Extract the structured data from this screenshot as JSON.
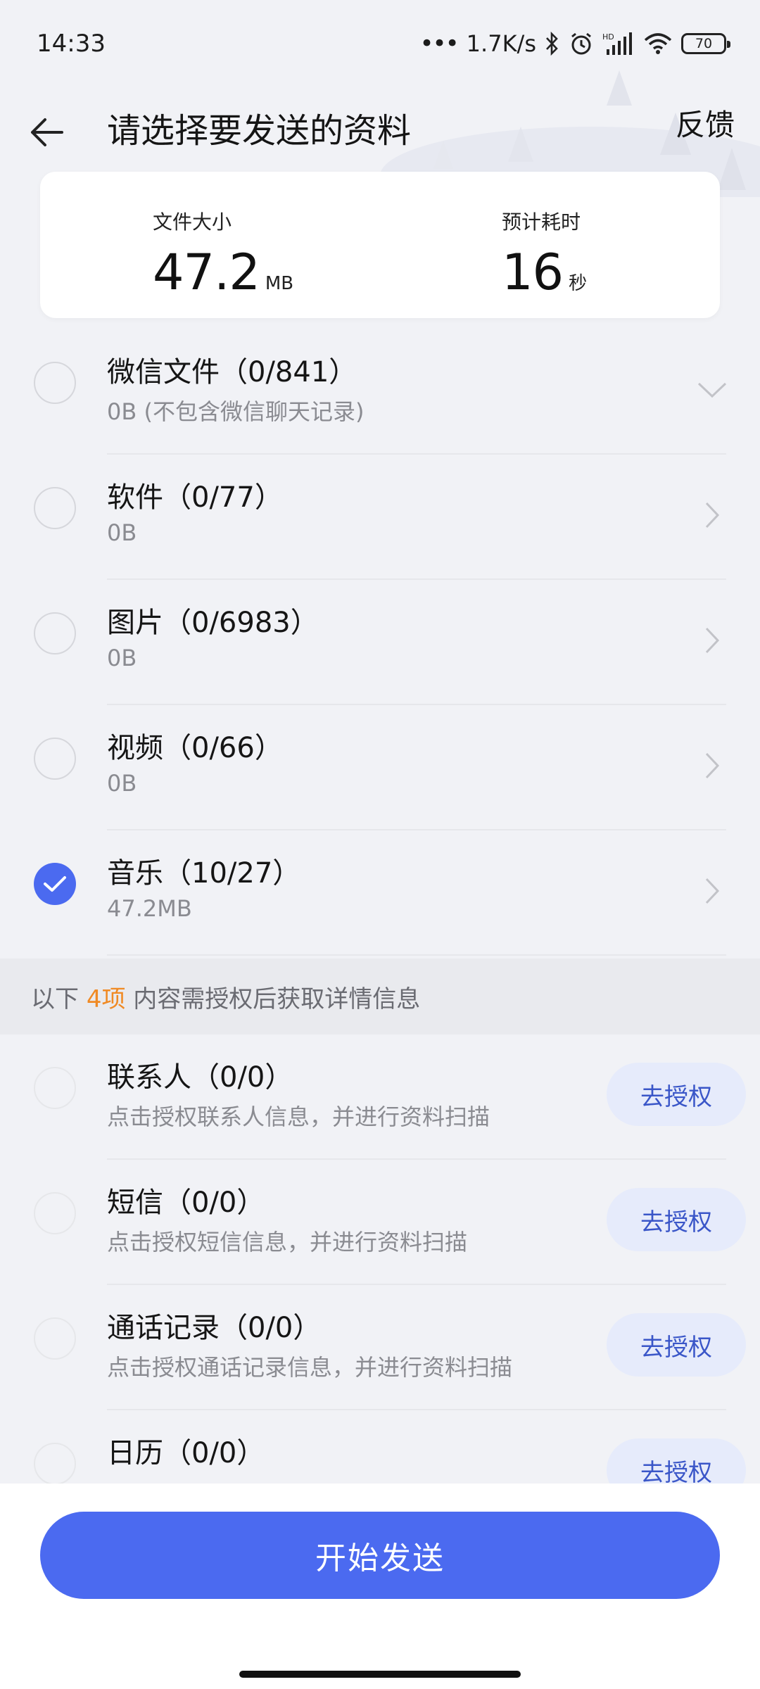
{
  "status_bar": {
    "time": "14:33",
    "network_speed": "1.7K/s",
    "battery_level": "70",
    "icons": [
      "dots-icon",
      "bluetooth-icon",
      "alarm-icon",
      "hd-signal-icon",
      "wifi-icon",
      "battery-icon"
    ]
  },
  "header": {
    "title": "请选择要发送的资料",
    "feedback_label": "反馈"
  },
  "summary": {
    "size_label": "文件大小",
    "size_value": "47.2",
    "size_unit": "MB",
    "time_label": "预计耗时",
    "time_value": "16",
    "time_unit": "秒"
  },
  "categories": [
    {
      "title": "微信文件（0/841）",
      "subtitle": "0B (不包含微信聊天记录)",
      "checked": false,
      "arrow": "chevron-down-icon"
    },
    {
      "title": "软件（0/77）",
      "subtitle": "0B",
      "checked": false,
      "arrow": "chevron-right-icon"
    },
    {
      "title": "图片（0/6983）",
      "subtitle": "0B",
      "checked": false,
      "arrow": "chevron-right-icon"
    },
    {
      "title": "视频（0/66）",
      "subtitle": "0B",
      "checked": false,
      "arrow": "chevron-right-icon"
    },
    {
      "title": "音乐（10/27）",
      "subtitle": "47.2MB",
      "checked": true,
      "arrow": "chevron-right-icon"
    }
  ],
  "notice": {
    "prefix": "以下 ",
    "count": "4项",
    "suffix": " 内容需授权后获取详情信息"
  },
  "auth_items": [
    {
      "title": "联系人（0/0）",
      "subtitle": "点击授权联系人信息，并进行资料扫描",
      "button": "去授权"
    },
    {
      "title": "短信（0/0）",
      "subtitle": "点击授权短信信息，并进行资料扫描",
      "button": "去授权"
    },
    {
      "title": "通话记录（0/0）",
      "subtitle": "点击授权通话记录信息，并进行资料扫描",
      "button": "去授权"
    },
    {
      "title": "日历（0/0）",
      "subtitle": "",
      "button": "去授权"
    }
  ],
  "send_button": "开始发送",
  "colors": {
    "accent": "#4b6af0",
    "highlight": "#f08a24",
    "auth_button_bg": "#e6ebfb",
    "auth_button_text": "#3a56c8"
  }
}
